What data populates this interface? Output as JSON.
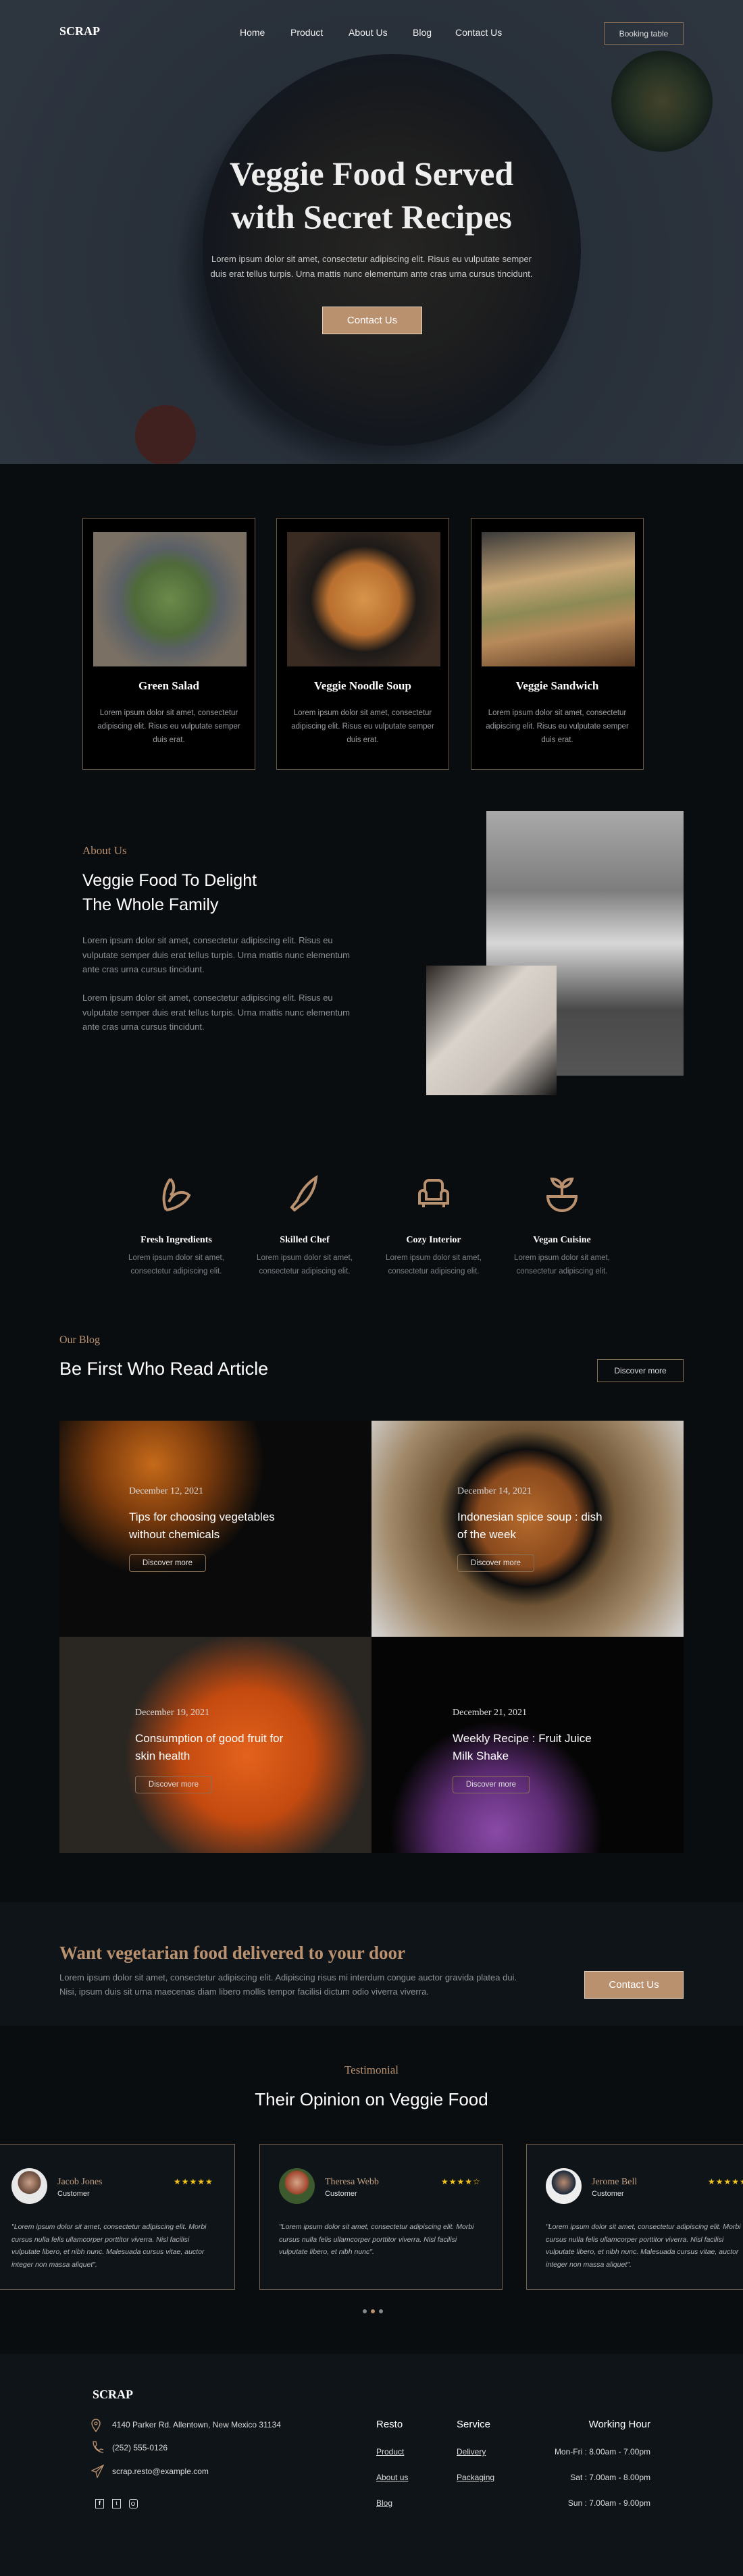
{
  "colors": {
    "accent": "#b9916f",
    "background": "#0a0d10",
    "panel": "#0f1418",
    "border": "#6b5a48",
    "star": "#f4c21b"
  },
  "header": {
    "logo": "SCRAP",
    "nav": [
      "Home",
      "Product",
      "About Us",
      "Blog",
      "Contact Us"
    ],
    "booking": "Booking table"
  },
  "hero": {
    "title_line1": "Veggie Food Served",
    "title_line2": "with Secret Recipes",
    "text_line1": "Lorem ipsum dolor sit amet, consectetur adipiscing elit. Risus eu vulputate semper",
    "text_line2": "duis erat tellus turpis. Urna mattis nunc elementum ante cras urna cursus tincidunt.",
    "cta": "Contact Us"
  },
  "menu": [
    {
      "title": "Green Salad",
      "desc": "Lorem ipsum dolor sit amet, consectetur adipiscing elit. Risus eu vulputate semper duis erat."
    },
    {
      "title": "Veggie Noodle Soup",
      "desc": "Lorem ipsum dolor sit amet, consectetur adipiscing elit. Risus eu vulputate semper duis erat."
    },
    {
      "title": "Veggie Sandwich",
      "desc": "Lorem ipsum dolor sit amet, consectetur adipiscing elit. Risus eu vulputate semper duis erat."
    }
  ],
  "about": {
    "label": "About Us",
    "title_line1": "Veggie Food To Delight",
    "title_line2": "The Whole Family",
    "para1": "Lorem ipsum dolor sit amet, consectetur adipiscing elit. Risus eu vulputate semper duis erat tellus turpis. Urna mattis nunc elementum ante cras urna cursus tincidunt.",
    "para2": "Lorem ipsum dolor sit amet, consectetur adipiscing elit. Risus eu vulputate semper duis erat tellus turpis. Urna mattis nunc elementum ante cras urna cursus tincidunt."
  },
  "features": [
    {
      "icon": "leaf-icon",
      "title": "Fresh Ingredients",
      "desc": "Lorem ipsum dolor sit amet, consectetur adipiscing elit."
    },
    {
      "icon": "knife-icon",
      "title": "Skilled Chef",
      "desc": "Lorem ipsum dolor sit amet, consectetur adipiscing elit."
    },
    {
      "icon": "armchair-icon",
      "title": "Cozy Interior",
      "desc": "Lorem ipsum dolor sit amet, consectetur adipiscing elit."
    },
    {
      "icon": "plant-bowl-icon",
      "title": "Vegan Cuisine",
      "desc": "Lorem ipsum dolor sit amet, consectetur adipiscing elit."
    }
  ],
  "blog": {
    "label": "Our Blog",
    "title": "Be First Who Read Article",
    "discover": "Discover more",
    "posts": [
      {
        "date": "December 12, 2021",
        "title": "Tips for choosing vegetables without chemicals",
        "button": "Discover more"
      },
      {
        "date": "December 14, 2021",
        "title": "Indonesian spice soup : dish of the week",
        "button": "Discover more"
      },
      {
        "date": "December 19, 2021",
        "title": "Consumption of good fruit for skin health",
        "button": "Discover more"
      },
      {
        "date": "December 21, 2021",
        "title": "Weekly Recipe : Fruit Juice Milk Shake",
        "button": "Discover more"
      }
    ]
  },
  "cta": {
    "title": "Want vegetarian food delivered to your door",
    "text": "Lorem ipsum dolor sit amet, consectetur adipiscing elit. Adipiscing risus mi interdum congue auctor gravida platea dui. Nisi, ipsum duis sit urna maecenas diam libero mollis tempor facilisi dictum odio viverra viverra.",
    "button": "Contact Us"
  },
  "testimonial": {
    "label": "Testimonial",
    "title": "Their Opinion on Veggie Food",
    "items": [
      {
        "name": "Jacob Jones",
        "role": "Customer",
        "rating": 5,
        "stars": "★★★★★",
        "quote": "\"Lorem ipsum dolor sit amet, consectetur adipiscing elit. Morbi cursus nulla felis ullamcorper porttitor viverra. Nisl facilisi vulputate libero, et nibh nunc. Malesuada cursus vitae, auctor integer non massa aliquet\"."
      },
      {
        "name": "Theresa Webb",
        "role": "Customer",
        "rating": 4,
        "stars": "★★★★☆",
        "quote": "\"Lorem ipsum dolor sit amet, consectetur adipiscing elit. Morbi cursus nulla felis ullamcorper porttitor viverra. Nisl facilisi vulputate libero, et nibh nunc\"."
      },
      {
        "name": "Jerome Bell",
        "role": "Customer",
        "rating": 5,
        "stars": "★★★★★",
        "quote": "\"Lorem ipsum dolor sit amet, consectetur adipiscing elit. Morbi cursus nulla felis ullamcorper porttitor viverra. Nisl facilisi vulputate libero, et nibh nunc. Malesuada cursus vitae, auctor integer non massa aliquet\"."
      }
    ],
    "active_page": 2,
    "pages": 3
  },
  "footer": {
    "logo": "SCRAP",
    "address": "4140 Parker Rd. Allentown, New Mexico 31134",
    "phone": "(252) 555-0126",
    "email": "scrap.resto@example.com",
    "social": [
      "facebook-icon",
      "twitter-icon",
      "instagram-icon"
    ],
    "resto": {
      "title": "Resto",
      "links": [
        "Product",
        "About us",
        "Blog"
      ]
    },
    "service": {
      "title": "Service",
      "links": [
        "Delivery",
        "Packaging"
      ]
    },
    "hours": {
      "title": "Working Hour",
      "rows": [
        "Mon-Fri : 8.00am - 7.00pm",
        "Sat : 7.00am - 8.00pm",
        "Sun : 7.00am - 9.00pm"
      ]
    }
  }
}
